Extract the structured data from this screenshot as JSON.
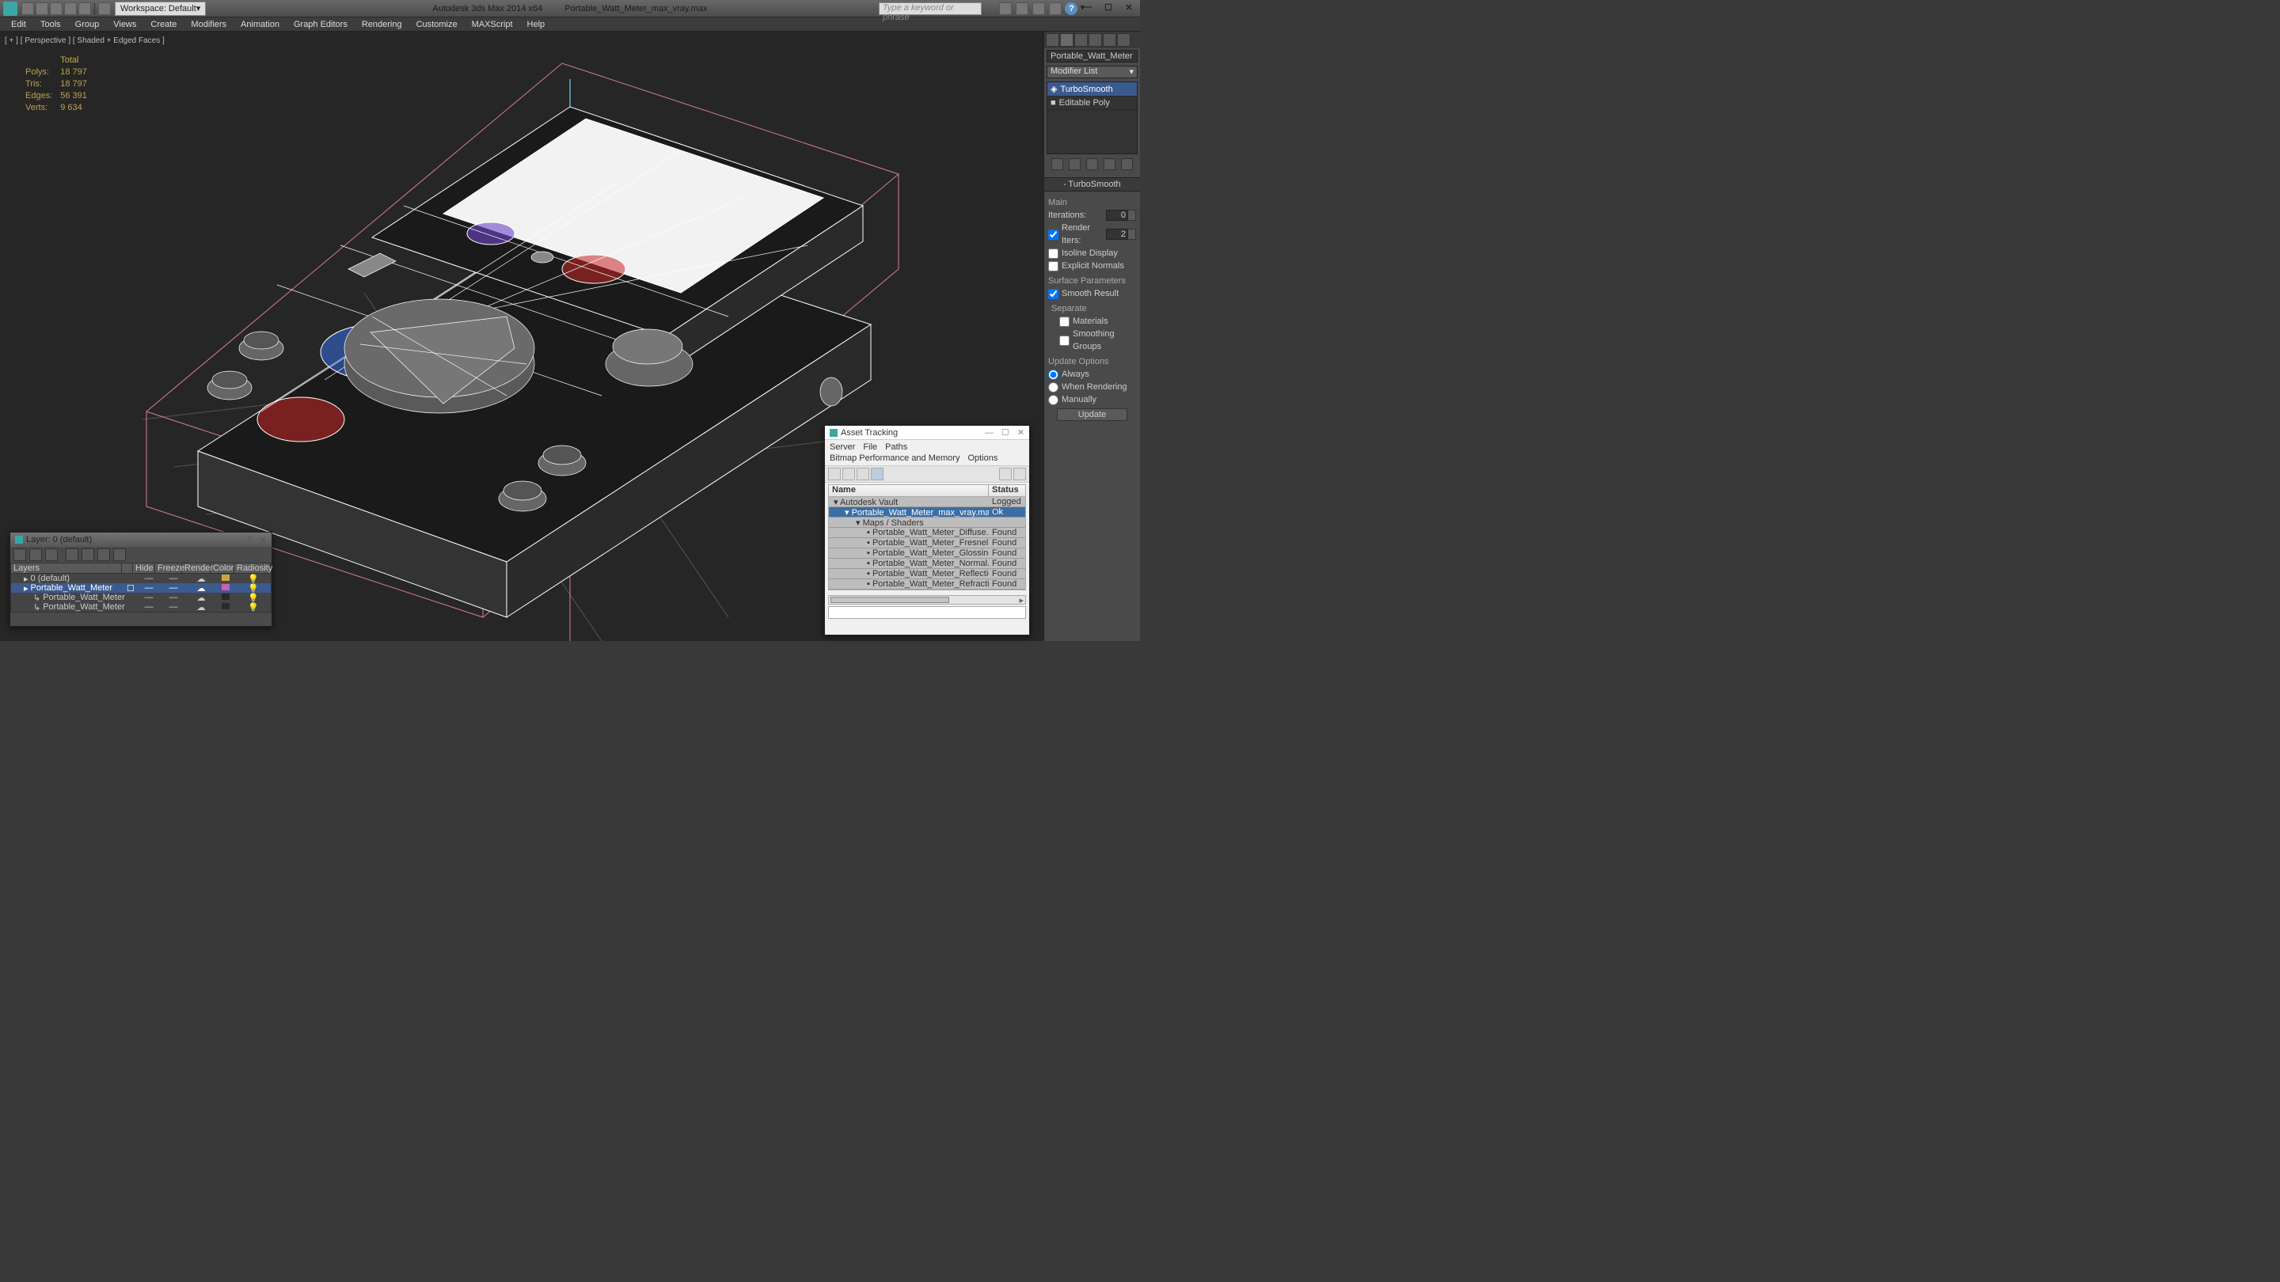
{
  "toolbar": {
    "workspace_label": "Workspace: Default",
    "app_title": "Autodesk 3ds Max 2014 x64",
    "file_name": "Portable_Watt_Meter_max_vray.max",
    "search_placeholder": "Type a keyword or phrase"
  },
  "menu": [
    "Edit",
    "Tools",
    "Group",
    "Views",
    "Create",
    "Modifiers",
    "Animation",
    "Graph Editors",
    "Rendering",
    "Customize",
    "MAXScript",
    "Help"
  ],
  "viewport": {
    "label": "[ + ] [ Perspective ] [ Shaded + Edged Faces ]",
    "stats": {
      "header": "Total",
      "polys_label": "Polys:",
      "polys": "18 797",
      "tris_label": "Tris:",
      "tris": "18 797",
      "edges_label": "Edges:",
      "edges": "56 391",
      "verts_label": "Verts:",
      "verts": "9 634"
    }
  },
  "command_panel": {
    "object_name": "Portable_Watt_Meter",
    "modifier_list_label": "Modifier List",
    "stack": [
      "TurboSmooth",
      "Editable Poly"
    ],
    "rollout_name": "TurboSmooth",
    "main_label": "Main",
    "iterations_label": "Iterations:",
    "iterations": "0",
    "render_iters_label": "Render Iters:",
    "render_iters": "2",
    "isoline_label": "Isoline Display",
    "explicit_label": "Explicit Normals",
    "surface_params": "Surface Parameters",
    "smooth_result": "Smooth Result",
    "separate_label": "Separate",
    "materials_label": "Materials",
    "smoothing_groups_label": "Smoothing Groups",
    "update_options": "Update Options",
    "always": "Always",
    "when_rendering": "When Rendering",
    "manually": "Manually",
    "update_btn": "Update"
  },
  "layer_dlg": {
    "title": "Layer: 0 (default)",
    "columns": [
      "Layers",
      "",
      "Hide",
      "Freeze",
      "Render",
      "Color",
      "Radiosity"
    ],
    "rows": [
      {
        "name": "0 (default)",
        "selected": false,
        "color": "#caa53b",
        "indent": 0
      },
      {
        "name": "Portable_Watt_Meter",
        "selected": true,
        "color": "#c95fb4",
        "indent": 0
      },
      {
        "name": "Portable_Watt_Meter",
        "selected": false,
        "color": "#2a2a2a",
        "indent": 1
      },
      {
        "name": "Portable_Watt_Meter",
        "selected": false,
        "color": "#2a2a2a",
        "indent": 1
      }
    ]
  },
  "asset_dlg": {
    "title": "Asset Tracking",
    "menus": [
      "Server",
      "File",
      "Paths",
      "Bitmap Performance and Memory",
      "Options"
    ],
    "columns": [
      "Name",
      "Status"
    ],
    "rows": [
      {
        "name": "Autodesk Vault",
        "status": "Logged O",
        "indent": 0,
        "sel": false
      },
      {
        "name": "Portable_Watt_Meter_max_vray.max",
        "status": "Ok",
        "indent": 1,
        "sel": true
      },
      {
        "name": "Maps / Shaders",
        "status": "",
        "indent": 2,
        "sel": false
      },
      {
        "name": "Portable_Watt_Meter_Diffuse.png",
        "status": "Found",
        "indent": 3,
        "sel": false
      },
      {
        "name": "Portable_Watt_Meter_Fresnel.png",
        "status": "Found",
        "indent": 3,
        "sel": false
      },
      {
        "name": "Portable_Watt_Meter_Glossiness.png",
        "status": "Found",
        "indent": 3,
        "sel": false
      },
      {
        "name": "Portable_Watt_Meter_Normal.png",
        "status": "Found",
        "indent": 3,
        "sel": false
      },
      {
        "name": "Portable_Watt_Meter_Reflection.png",
        "status": "Found",
        "indent": 3,
        "sel": false
      },
      {
        "name": "Portable_Watt_Meter_Refraction.png",
        "status": "Found",
        "indent": 3,
        "sel": false
      }
    ]
  }
}
